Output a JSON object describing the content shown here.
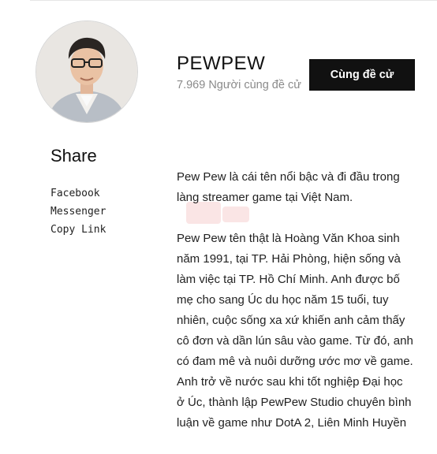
{
  "profile": {
    "name": "PEWPEW",
    "followers": "7.969 Người cùng đề cử",
    "vote_label": "Cùng đề cử"
  },
  "share": {
    "title": "Share",
    "items": [
      "Facebook",
      "Messenger",
      "Copy Link"
    ]
  },
  "bio": {
    "paragraphs": [
      "Pew Pew là cái tên nổi bậc và đi đầu trong làng streamer game tại Việt Nam.",
      "Pew Pew tên thật là Hoàng Văn Khoa sinh năm 1991, tại TP. Hải Phòng, hiện sống và làm việc tại TP. Hồ Chí Minh. Anh được bố mẹ cho sang Úc du học năm 15 tuổi, tuy nhiên, cuộc sống xa xứ khiến anh cảm thấy cô đơn và dần lún sâu vào game. Từ đó, anh có đam mê và nuôi dưỡng ước mơ về game. Anh trở về nước sau khi tốt nghiệp Đại học ở Úc, thành lập PewPew Studio chuyên bình luận về game như DotA 2, Liên Minh Huyền"
    ]
  },
  "colors": {
    "button_bg": "#111111",
    "button_text": "#ffffff",
    "muted_text": "#8a8a8a"
  }
}
